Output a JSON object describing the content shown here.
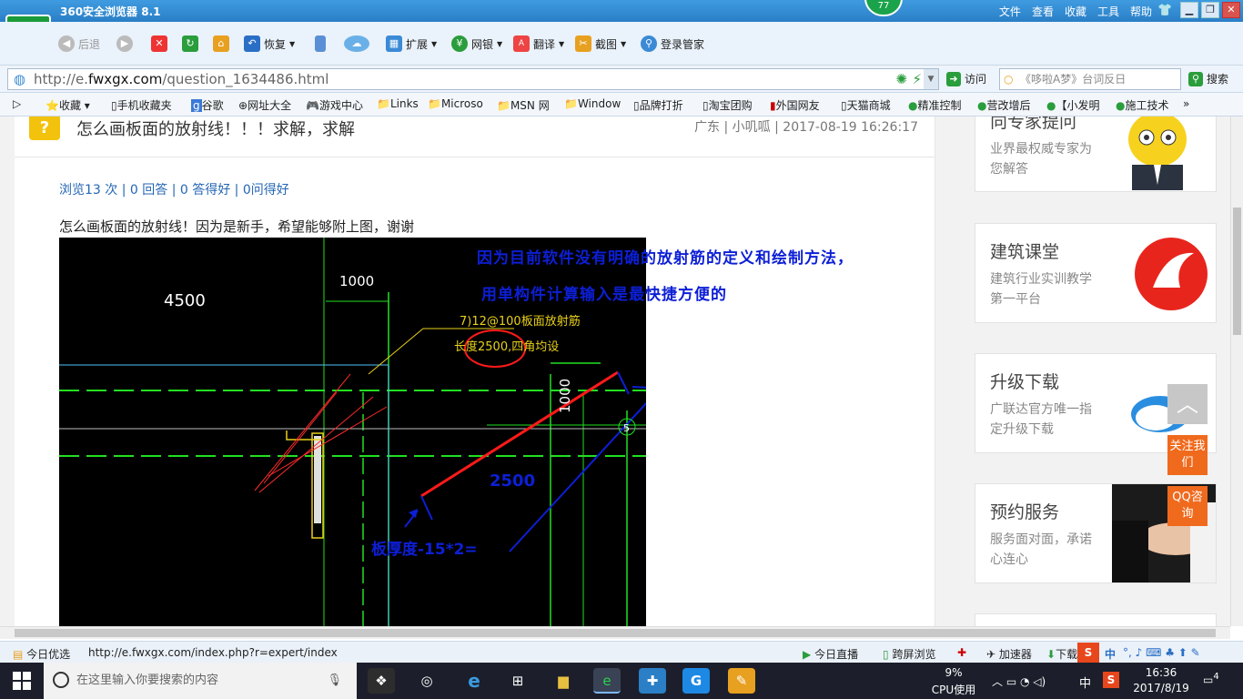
{
  "browser": {
    "title": "360安全浏览器 8.1",
    "badge_count": "77",
    "menu": [
      "文件",
      "查看",
      "收藏",
      "工具",
      "帮助"
    ],
    "toolbar": {
      "back": "后退",
      "restore": "恢复",
      "extend": "扩展",
      "bank": "网银",
      "translate": "翻译",
      "screenshot": "截图",
      "login": "登录管家"
    },
    "address": {
      "prefix": "http://e.",
      "domain": "fwxgx.com",
      "path": "/question_1634486.html",
      "visit": "访问",
      "search_placeholder": "《哆啦A梦》台词反日",
      "search_button": "搜索"
    },
    "favorites": [
      "收藏",
      "手机收藏夹",
      "谷歌",
      "网址大全",
      "游戏中心",
      "Links",
      "Microso",
      "MSN 网",
      "Window",
      "品牌打折",
      "淘宝团购",
      "外国网友",
      "天猫商城",
      "精准控制",
      "营改增后",
      "【小发明",
      "施工技术"
    ]
  },
  "question": {
    "icon": "?",
    "title": "怎么画板面的放射线！！！求解，求解",
    "meta": "广东 | 小叽呱 | 2017-08-19 16:26:17",
    "stats": "浏览13 次 | 0 回答 | 0 答得好 | 0问得好",
    "body": "怎么画板面的放射线！因为是新手，希望能够附上图，谢谢",
    "annotation_line1": "因为目前软件没有明确的放射筋的定义和绘制方法，",
    "annotation_line2": "用单构件计算输入是最快捷方便的"
  },
  "cad": {
    "dim_4500": "4500",
    "dim_1000_top": "1000",
    "rebar_label": "7)12@100板面放射筋",
    "length_label": "长度2500,四角均设",
    "dim_1000_side": "1000",
    "dim_2500": "2500",
    "thickness_label": "板厚度-15*2=",
    "marker": "5"
  },
  "sidebar": {
    "cards": [
      {
        "title": "向专家提问",
        "sub": "业界最权威专家为您解答"
      },
      {
        "title": "建筑课堂",
        "sub": "建筑行业实训教学第一平台"
      },
      {
        "title": "升级下载",
        "sub": "广联达官方唯一指定升级下载"
      },
      {
        "title": "预约服务",
        "sub": "服务面对面，承诺心连心"
      }
    ],
    "follow": "关注我们",
    "qq": "QQ咨询",
    "up_arrow": "︿"
  },
  "statusbar": {
    "today_pick": "今日优选",
    "link_url": "http://e.fwxgx.com/index.php?r=expert/index",
    "live": "今日直播",
    "cross_screen": "跨屏浏览",
    "accelerator": "加速器",
    "download": "下载",
    "ime": "中"
  },
  "taskbar": {
    "search_placeholder": "在这里输入你要搜索的内容",
    "cpu_percent": "9%",
    "cpu_label": "CPU使用",
    "time": "16:36",
    "date": "2017/8/19",
    "lang": "中",
    "notifications": "4"
  },
  "colors": {
    "titlebar": "#2a7fc6",
    "accent_orange": "#f06a1d",
    "cad_bg": "#000000",
    "cad_green": "#22e022",
    "annotation_blue": "#0d1fd6",
    "rebar_red": "#ff1a1a"
  }
}
